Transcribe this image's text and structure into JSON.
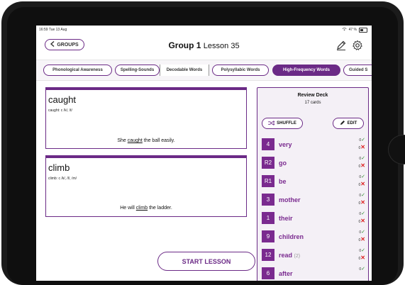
{
  "status": {
    "time": "16:59",
    "date": "Tue 13 Aug",
    "wifi": "wifi-icon",
    "battery": "47 %"
  },
  "header": {
    "back_label": "GROUPS",
    "group": "Group 1",
    "lesson": "Lesson 35"
  },
  "tabs": [
    {
      "label": "Phonological Awareness",
      "active": false
    },
    {
      "label": "Spelling-Sounds",
      "active": false
    },
    {
      "label": "Decodable Words",
      "active": false
    },
    {
      "label": "Polysyllabic Words",
      "active": false
    },
    {
      "label": "High-Frequency Words",
      "active": true
    },
    {
      "label": "Guided S",
      "active": false
    }
  ],
  "cards": [
    {
      "word": "caught",
      "phonics": "caught: c /k/, /t/",
      "sentence_before": "She ",
      "sentence_word": "caught",
      "sentence_after": " the ball easily."
    },
    {
      "word": "climb",
      "phonics": "climb: c /k/, /l/, /m/",
      "sentence_before": "He will ",
      "sentence_word": "climb",
      "sentence_after": " the ladder."
    }
  ],
  "start_label": "START LESSON",
  "deck": {
    "title": "Review Deck",
    "count": "17 cards",
    "shuffle_label": "SHUFFLE",
    "edit_label": "EDIT",
    "items": [
      {
        "num": "4",
        "word": "very",
        "extra": "",
        "correct": "0",
        "wrong": "0"
      },
      {
        "num": "R2",
        "word": "go",
        "extra": "",
        "correct": "0",
        "wrong": "0"
      },
      {
        "num": "R1",
        "word": "be",
        "extra": "",
        "correct": "0",
        "wrong": "0"
      },
      {
        "num": "3",
        "word": "mother",
        "extra": "",
        "correct": "0",
        "wrong": "0"
      },
      {
        "num": "1",
        "word": "their",
        "extra": "",
        "correct": "0",
        "wrong": "0"
      },
      {
        "num": "9",
        "word": "children",
        "extra": "",
        "correct": "0",
        "wrong": "0"
      },
      {
        "num": "12",
        "word": "read",
        "extra": "(2)",
        "correct": "0",
        "wrong": "0"
      },
      {
        "num": "6",
        "word": "after",
        "extra": "",
        "correct": "0",
        "wrong": ""
      }
    ]
  },
  "colors": {
    "accent": "#6b2a86",
    "check": "#2a8a2a",
    "cross": "#dd2222"
  }
}
